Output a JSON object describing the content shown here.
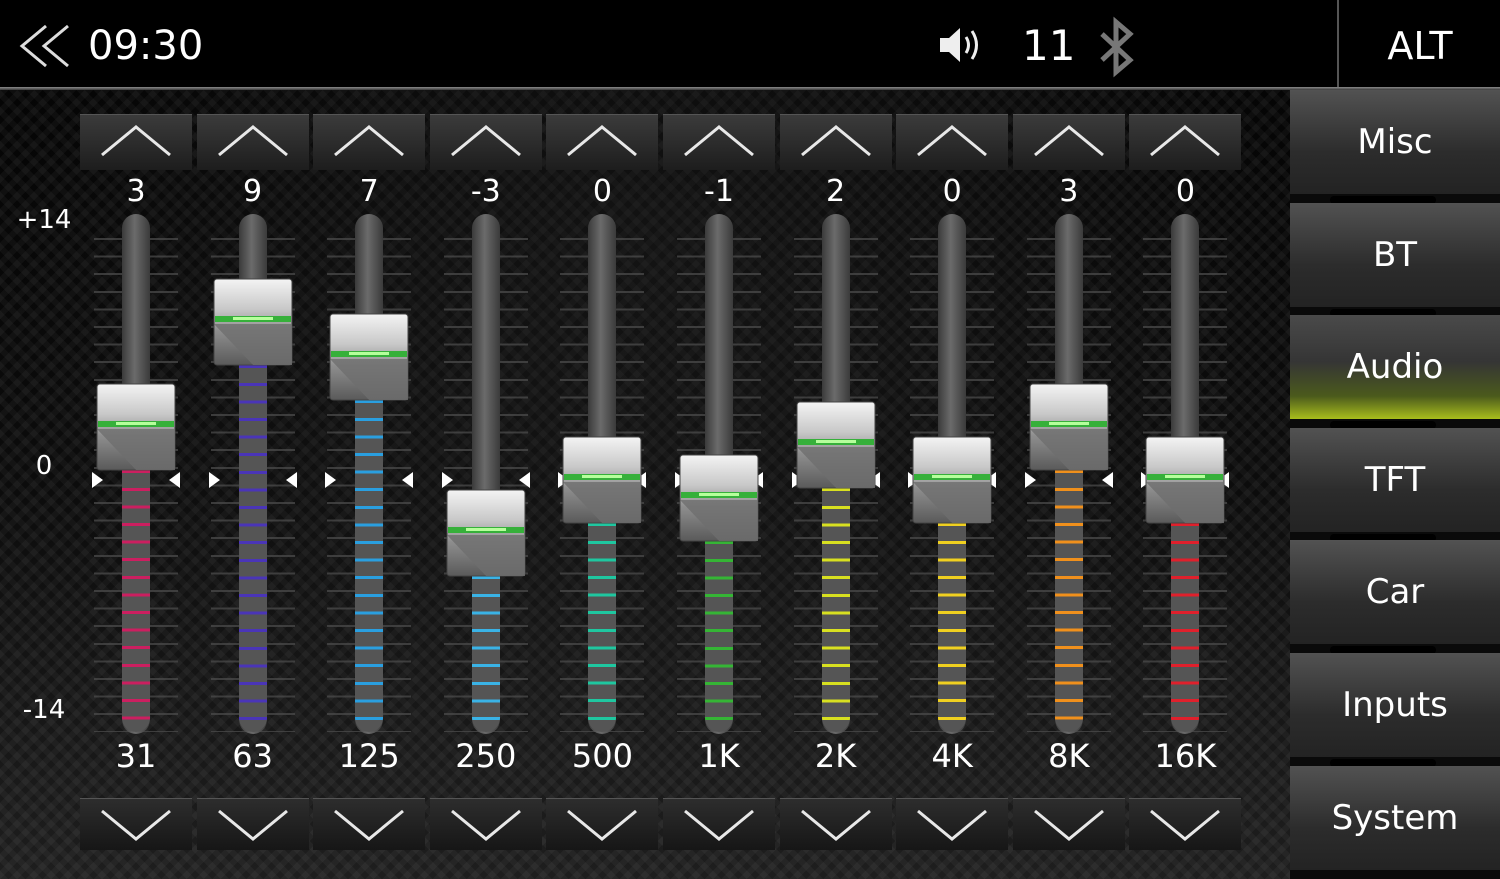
{
  "status_bar": {
    "time": "09:30",
    "volume": "11",
    "alt_button": "ALT",
    "icons": {
      "back": "double-chevron-left-icon",
      "volume": "speaker-icon",
      "bluetooth": "bluetooth-icon"
    }
  },
  "equalizer": {
    "scale": {
      "max": "+14",
      "mid": "0",
      "min": "-14"
    },
    "range": [
      -14,
      14
    ],
    "bands": [
      {
        "freq": "31",
        "value": "3",
        "level": 3,
        "color": "#cc1f60"
      },
      {
        "freq": "63",
        "value": "9",
        "level": 9,
        "color": "#4a35b8"
      },
      {
        "freq": "125",
        "value": "7",
        "level": 7,
        "color": "#2a9fe0"
      },
      {
        "freq": "250",
        "value": "-3",
        "level": -3,
        "color": "#3ab3e6"
      },
      {
        "freq": "500",
        "value": "0",
        "level": 0,
        "color": "#1fc7a0"
      },
      {
        "freq": "1K",
        "value": "-1",
        "level": -1,
        "color": "#35b535"
      },
      {
        "freq": "2K",
        "value": "2",
        "level": 2,
        "color": "#d8e020"
      },
      {
        "freq": "4K",
        "value": "0",
        "level": 0,
        "color": "#f0d020"
      },
      {
        "freq": "8K",
        "value": "3",
        "level": 3,
        "color": "#f0901c"
      },
      {
        "freq": "16K",
        "value": "0",
        "level": 0,
        "color": "#e0202c"
      }
    ]
  },
  "menu": {
    "items": [
      "Misc",
      "BT",
      "Audio",
      "TFT",
      "Car",
      "Inputs",
      "System"
    ],
    "active": "Audio",
    "active_color": "#a8bd1c"
  }
}
